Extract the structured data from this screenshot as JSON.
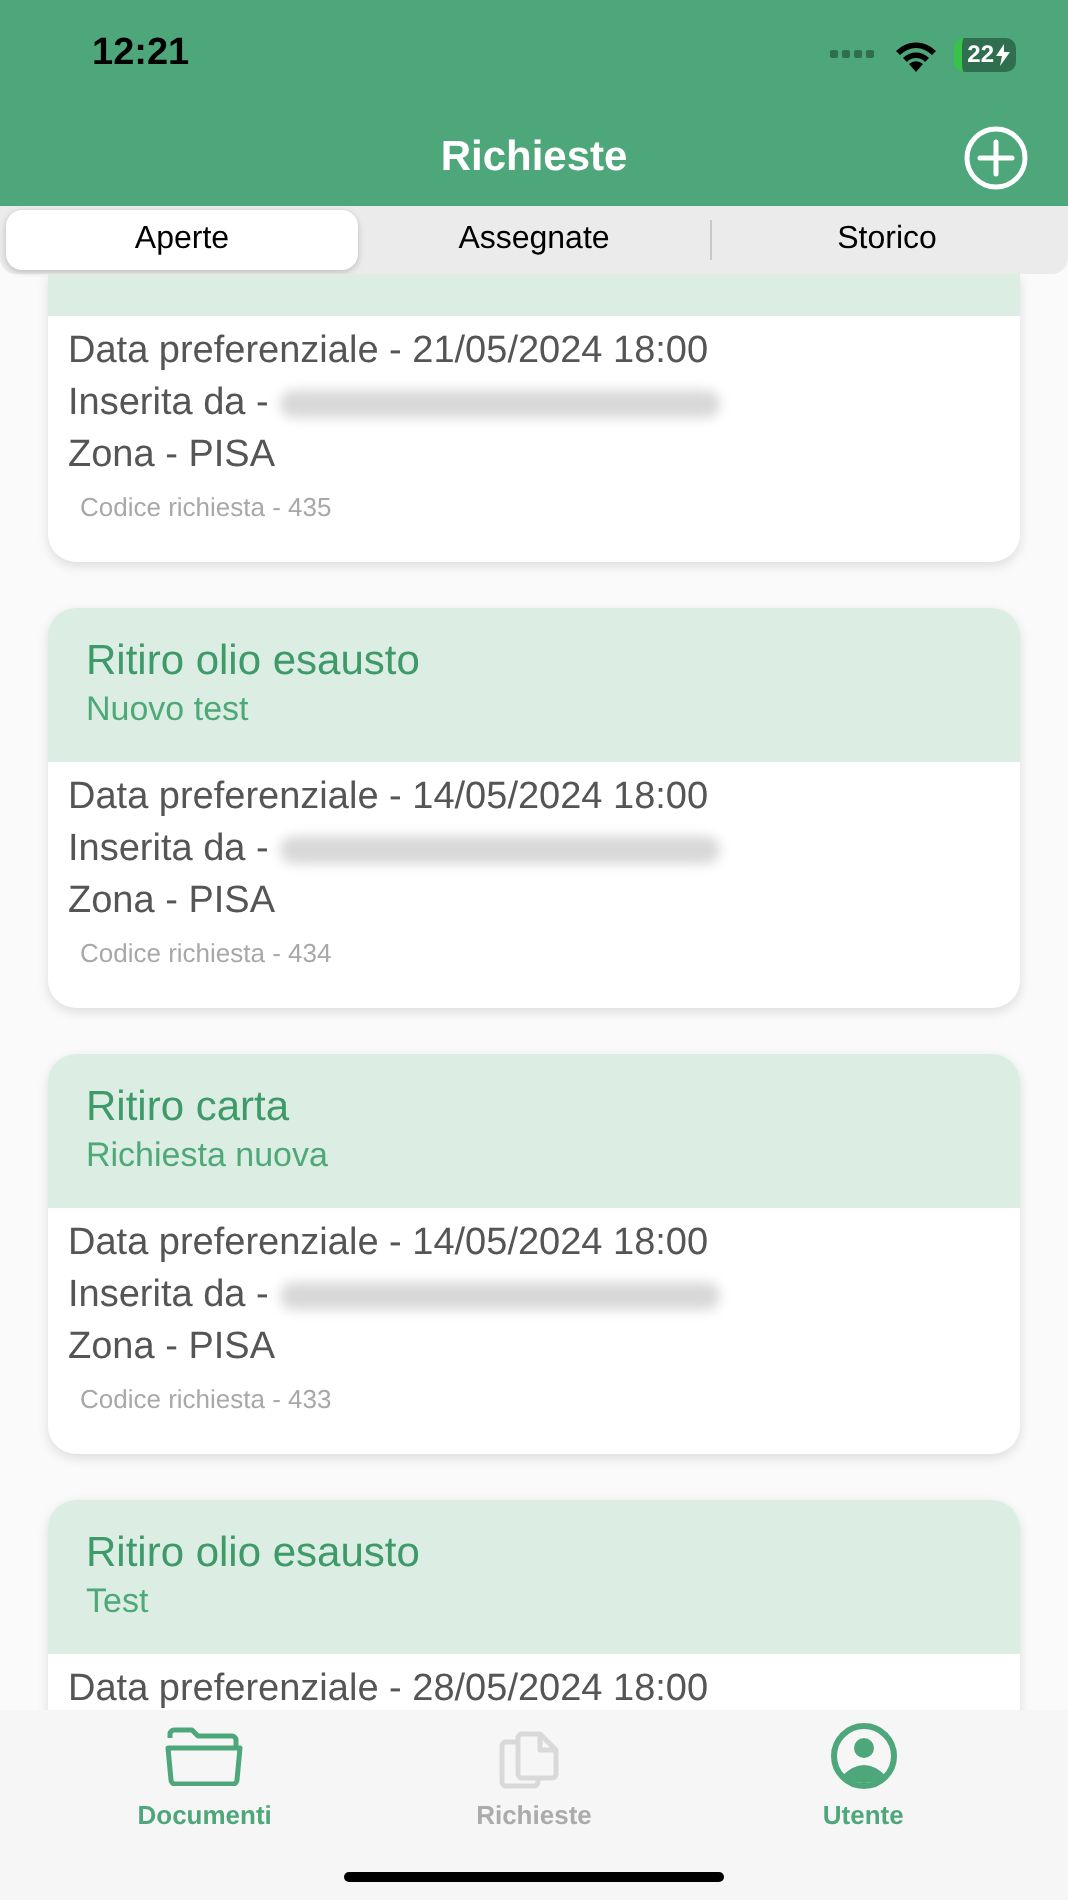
{
  "status_bar": {
    "time": "12:21",
    "battery": "22"
  },
  "header": {
    "title": "Richieste"
  },
  "tabs": [
    {
      "label": "Aperte",
      "selected": true
    },
    {
      "label": "Assegnate",
      "selected": false
    },
    {
      "label": "Storico",
      "selected": false
    }
  ],
  "requests": [
    {
      "date": "Data preferenziale - 21/05/2024 18:00",
      "inserted_by": "Inserita da -",
      "zone": "Zona - PISA",
      "code": "Codice richiesta - 435"
    },
    {
      "title": "Ritiro olio esausto",
      "subtitle": "Nuovo test",
      "date": "Data preferenziale - 14/05/2024 18:00",
      "inserted_by": "Inserita da -",
      "zone": "Zona - PISA",
      "code": "Codice richiesta - 434"
    },
    {
      "title": "Ritiro carta",
      "subtitle": "Richiesta nuova",
      "date": "Data preferenziale - 14/05/2024 18:00",
      "inserted_by": "Inserita da -",
      "zone": "Zona - PISA",
      "code": "Codice richiesta - 433"
    },
    {
      "title": "Ritiro olio esausto",
      "subtitle": "Test",
      "date": "Data preferenziale - 28/05/2024 18:00"
    }
  ],
  "bottom_nav": [
    {
      "kind": "folder",
      "label": "Documenti",
      "disabled": false
    },
    {
      "kind": "documents",
      "label": "Richieste",
      "disabled": true
    },
    {
      "kind": "user",
      "label": "Utente",
      "disabled": false
    }
  ]
}
